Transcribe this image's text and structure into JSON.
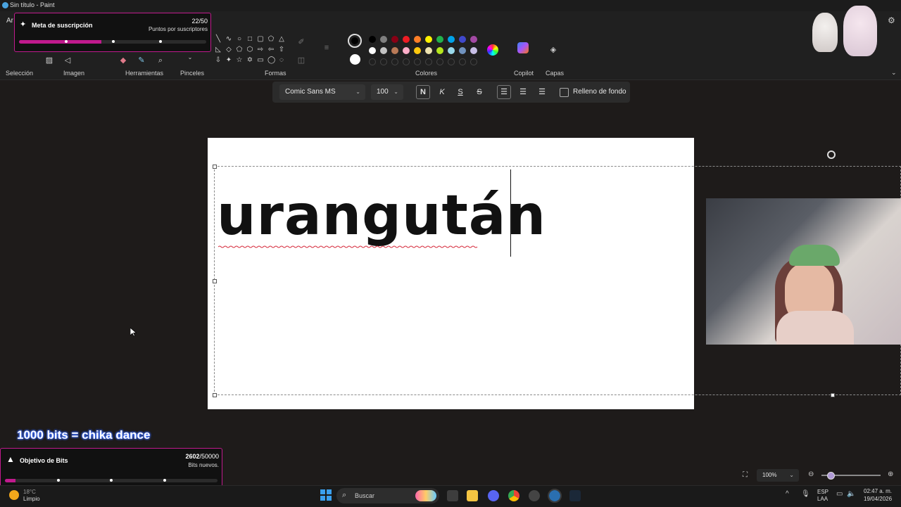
{
  "window": {
    "title": "Sin título - Paint",
    "file_menu_partial": "Ar"
  },
  "ribbon": {
    "groups": [
      "Selección",
      "Imagen",
      "Herramientas",
      "Pinceles",
      "Formas",
      "Colores",
      "Copilot",
      "Capas"
    ],
    "colors_row1": [
      "#000000",
      "#7f7f7f",
      "#880015",
      "#ed1c24",
      "#ff7f27",
      "#fff200",
      "#22b14c",
      "#00a2e8",
      "#3f48cc",
      "#a349a4"
    ],
    "colors_row2": [
      "#ffffff",
      "#c3c3c3",
      "#b97a57",
      "#ffaec9",
      "#ffc90e",
      "#efe4b0",
      "#b5e61d",
      "#99d9ea",
      "#7092be",
      "#c8bfe7"
    ],
    "primary_color": "#000000",
    "secondary_color": "#ffffff"
  },
  "text_toolbar": {
    "font": "Comic Sans MS",
    "size": "100",
    "bold": "N",
    "italic": "K",
    "underline": "S",
    "strike": "S",
    "fill_label": "Relleno de fondo"
  },
  "canvas": {
    "text": "urangután"
  },
  "sub_goal": {
    "title": "Meta de suscripción",
    "count": "22/50",
    "subtitle": "Puntos por suscriptores",
    "progress": 0.44
  },
  "bits_goal": {
    "title": "Objetivo de Bits",
    "current": "2602",
    "total": "/50000",
    "subtitle": "Bits nuevos.",
    "progress": 0.05
  },
  "promo": "1000 bits = chika dance",
  "statusbar": {
    "zoom": "100%"
  },
  "taskbar": {
    "weather_line1": "18°C",
    "weather_line2": "Limpio",
    "search_placeholder": "Buscar",
    "lang1": "ESP",
    "lang2": "LAA",
    "time": "02:47 a. m.",
    "date": "19/04/2026"
  },
  "colors": {
    "accent": "#c01a8d"
  }
}
